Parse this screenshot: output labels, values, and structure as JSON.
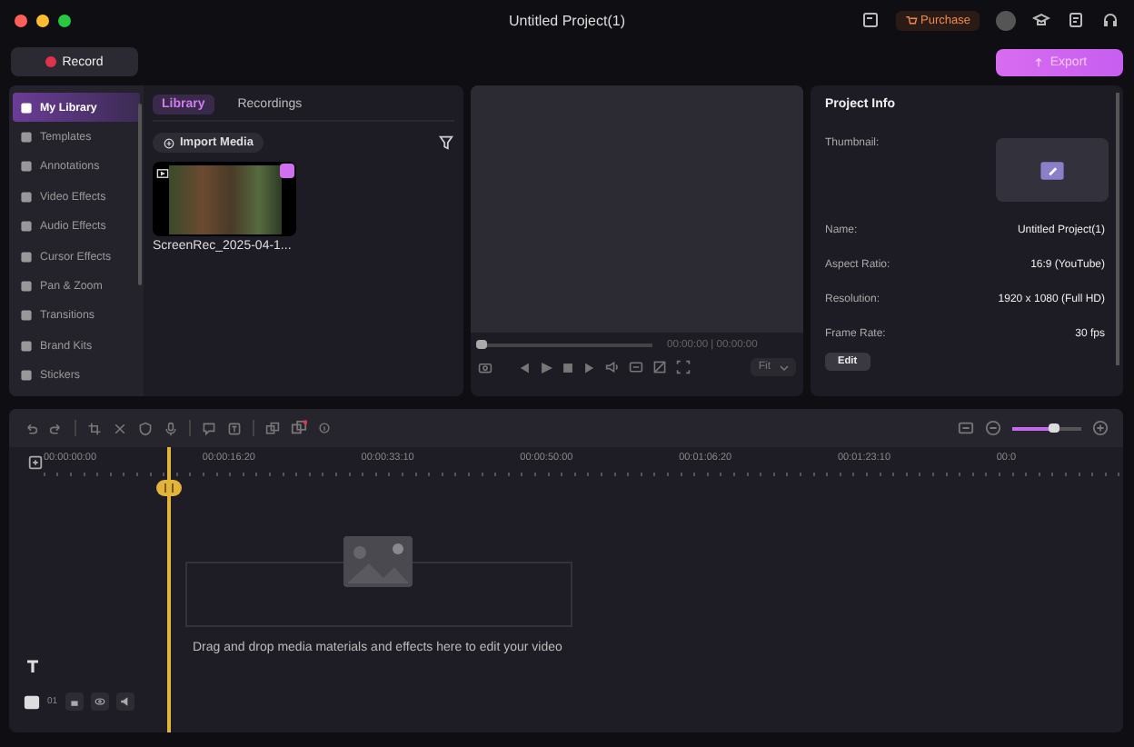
{
  "window": {
    "title": "Untitled Project(1)"
  },
  "header": {
    "purchase": "Purchase"
  },
  "record_button": "Record",
  "export_button": {
    "label": "Export",
    "disabled": true
  },
  "sidebar": {
    "items": [
      {
        "label": "My Library",
        "selected": true
      },
      {
        "label": "Templates",
        "selected": false
      },
      {
        "label": "Annotations",
        "selected": false
      },
      {
        "label": "Video Effects",
        "selected": false
      },
      {
        "label": "Audio Effects",
        "selected": false
      },
      {
        "label": "Cursor Effects",
        "selected": false
      },
      {
        "label": "Pan & Zoom",
        "selected": false
      },
      {
        "label": "Transitions",
        "selected": false
      },
      {
        "label": "Brand Kits",
        "selected": false
      },
      {
        "label": "Stickers",
        "selected": false
      }
    ]
  },
  "library": {
    "tabs": [
      {
        "label": "Library",
        "selected": true
      },
      {
        "label": "Recordings",
        "selected": false
      }
    ],
    "import_button": "Import Media",
    "media": [
      {
        "name": "ScreenRec_2025-04-1..."
      }
    ]
  },
  "preview": {
    "seek": {
      "level": 0
    },
    "time": "00:00:00 | 00:00:00",
    "fit": "Fit"
  },
  "project_info": {
    "title": "Project Info",
    "thumbnail_label": "Thumbnail:",
    "rows": [
      {
        "label": "Name:",
        "value": "Untitled Project(1)"
      },
      {
        "label": "Aspect Ratio:",
        "value": "16:9 (YouTube)"
      },
      {
        "label": "Resolution:",
        "value": "1920 x 1080 (Full HD)"
      },
      {
        "label": "Frame Rate:",
        "value": "30 fps"
      }
    ],
    "edit_button": "Edit"
  },
  "timeline": {
    "zoom": {
      "level": 0.6
    },
    "ruler": [
      "00:00:00:00",
      "00:00:16:20",
      "00:00:33:10",
      "00:00:50:00",
      "00:01:06:20",
      "00:01:23:10",
      "00:0"
    ],
    "track_number": "01",
    "drop_hint": "Drag and drop media materials and effects here to edit your video"
  }
}
